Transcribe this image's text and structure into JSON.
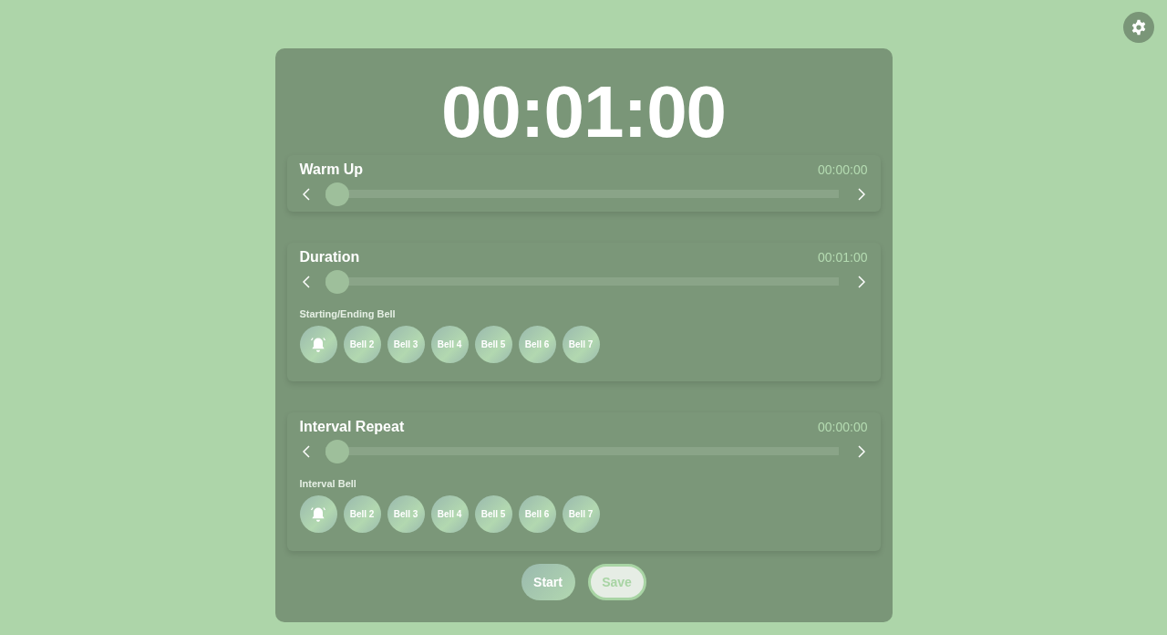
{
  "timer": "00:01:00",
  "sections": [
    {
      "title": "Warm Up",
      "time": "00:00:00",
      "level": 0
    },
    {
      "title": "Duration",
      "time": "00:01:00",
      "level": 0,
      "bells_label": "Starting/Ending Bell",
      "bells": [
        {
          "kind": "icon"
        },
        {
          "kind": "label",
          "label": "Bell 2"
        },
        {
          "kind": "label",
          "label": "Bell 3"
        },
        {
          "kind": "label",
          "label": "Bell 4"
        },
        {
          "kind": "label",
          "label": "Bell 5"
        },
        {
          "kind": "label",
          "label": "Bell 6"
        },
        {
          "kind": "label",
          "label": "Bell 7"
        }
      ]
    },
    {
      "title": "Interval Repeat",
      "time": "00:00:00",
      "level": 0,
      "bells_label": "Interval Bell",
      "bells": [
        {
          "kind": "icon"
        },
        {
          "kind": "label",
          "label": "Bell 2"
        },
        {
          "kind": "label",
          "label": "Bell 3"
        },
        {
          "kind": "label",
          "label": "Bell 4"
        },
        {
          "kind": "label",
          "label": "Bell 5"
        },
        {
          "kind": "label",
          "label": "Bell 6"
        },
        {
          "kind": "label",
          "label": "Bell 7"
        }
      ]
    }
  ],
  "buttons": [
    {
      "label": "Start",
      "kind": "primary"
    },
    {
      "label": "Save",
      "kind": "outline"
    }
  ]
}
